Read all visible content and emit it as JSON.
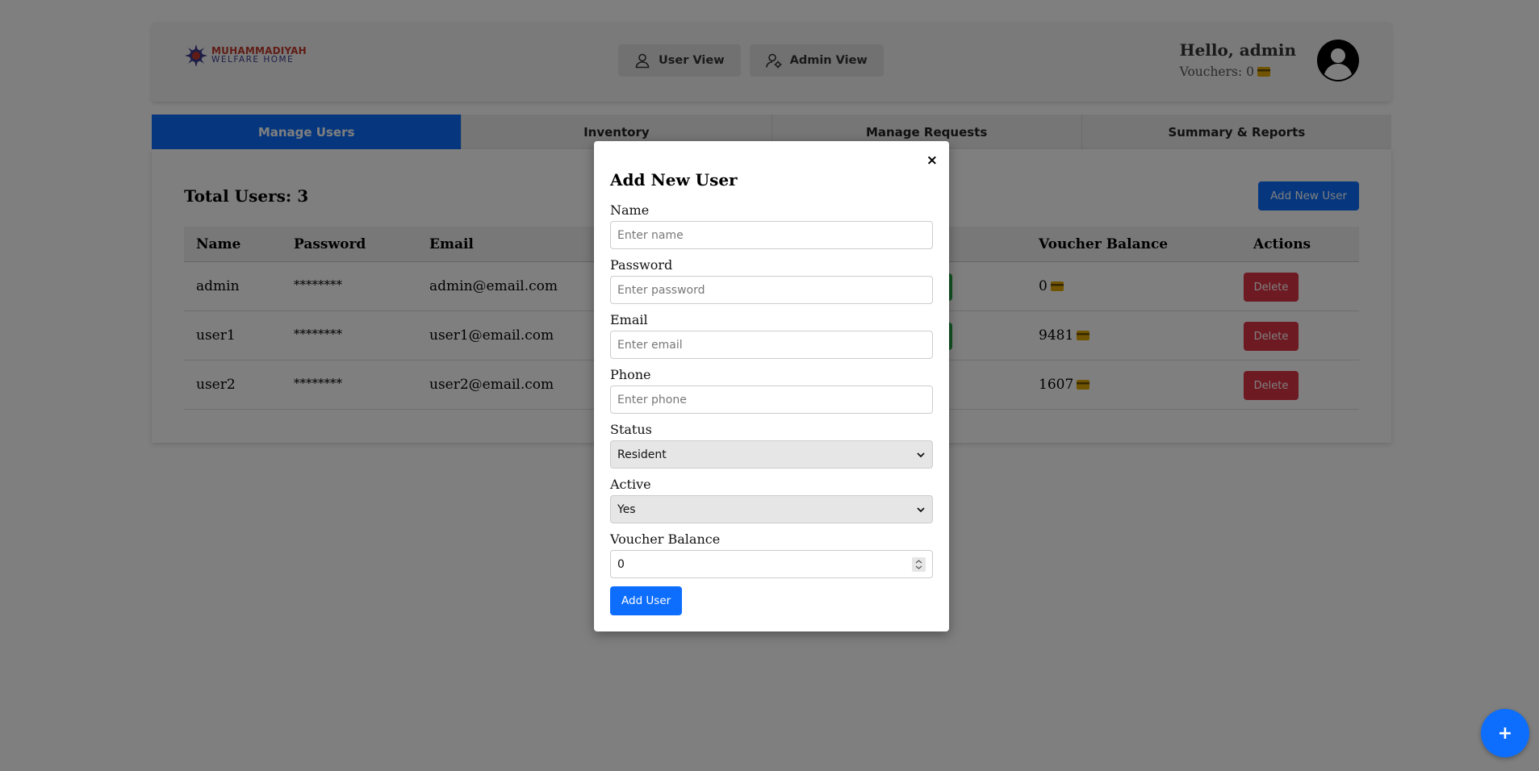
{
  "header": {
    "logo": {
      "line1": "MUHAMMADIYAH",
      "line2": "WELFARE HOME"
    },
    "view_buttons": [
      {
        "label": "User View",
        "icon": "user-icon"
      },
      {
        "label": "Admin View",
        "icon": "user-gear-icon"
      }
    ],
    "greeting": "Hello, admin",
    "vouchers": "Vouchers: 0"
  },
  "tabs": [
    {
      "label": "Manage Users",
      "active": true
    },
    {
      "label": "Inventory",
      "active": false
    },
    {
      "label": "Manage Requests",
      "active": false
    },
    {
      "label": "Summary & Reports",
      "active": false
    }
  ],
  "users_panel": {
    "total": "Total Users: 3",
    "add_new_label": "Add New User",
    "columns": [
      "Name",
      "Password",
      "Email",
      "Voucher Balance",
      "Actions"
    ],
    "rows": [
      {
        "name": "admin",
        "password": "********",
        "email": "admin@email.com",
        "balance": "0",
        "status_color": "#28a745",
        "delete_label": "Delete"
      },
      {
        "name": "user1",
        "password": "********",
        "email": "user1@email.com",
        "balance": "9481",
        "status_color": "#28a745",
        "delete_label": "Delete"
      },
      {
        "name": "user2",
        "password": "********",
        "email": "user2@email.com",
        "balance": "1607",
        "status_color": "#dc3545",
        "delete_label": "Delete"
      }
    ]
  },
  "modal": {
    "close": "×",
    "title": "Add New User",
    "fields": {
      "name": {
        "label": "Name",
        "placeholder": "Enter name"
      },
      "password": {
        "label": "Password",
        "placeholder": "Enter password"
      },
      "email": {
        "label": "Email",
        "placeholder": "Enter email"
      },
      "phone": {
        "label": "Phone",
        "placeholder": "Enter phone"
      },
      "status": {
        "label": "Status",
        "value": "Resident"
      },
      "active": {
        "label": "Active",
        "value": "Yes"
      },
      "voucher_balance": {
        "label": "Voucher Balance",
        "value": "0"
      }
    },
    "submit_label": "Add User"
  },
  "fab": {
    "label": "+"
  },
  "colors": {
    "primary": "#0d6efd",
    "danger": "#dc3545",
    "success": "#28a745"
  }
}
